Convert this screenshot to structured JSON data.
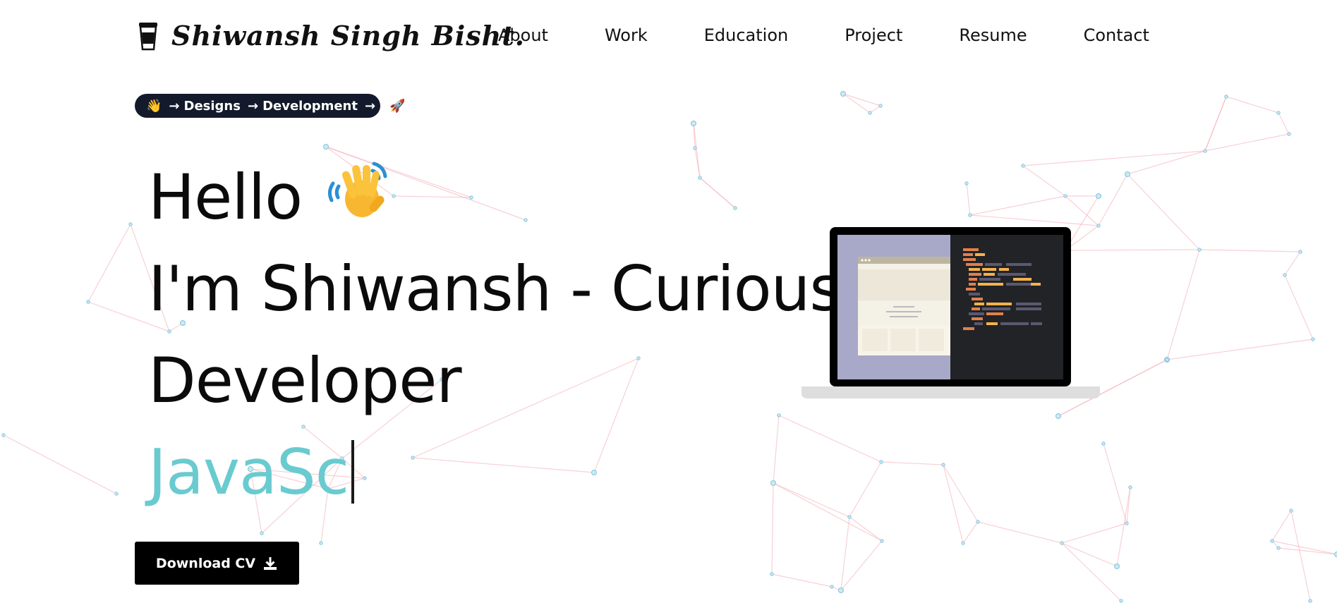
{
  "brand": {
    "name": "Shiwansh Singh Bisht."
  },
  "nav": {
    "items": [
      {
        "label": "About"
      },
      {
        "label": "Work"
      },
      {
        "label": "Education"
      },
      {
        "label": "Project"
      },
      {
        "label": "Resume"
      },
      {
        "label": "Contact"
      }
    ]
  },
  "tagline": {
    "part1": "Designs",
    "part2": "Development"
  },
  "hero": {
    "greeting": "Hello",
    "line2": "I'm Shiwansh - Curious",
    "line3": "Developer",
    "typed_text": "JavaSc"
  },
  "cta": {
    "download_label": "Download CV"
  },
  "colors": {
    "accent": "#69cbd0",
    "pill_bg": "#121a2b",
    "network_line": "#f2a9b5",
    "network_node": "#7ec6de"
  },
  "icons": [
    "coffee-cup-icon",
    "waving-hand-icon",
    "rocket-icon",
    "download-icon",
    "laptop-illustration"
  ]
}
